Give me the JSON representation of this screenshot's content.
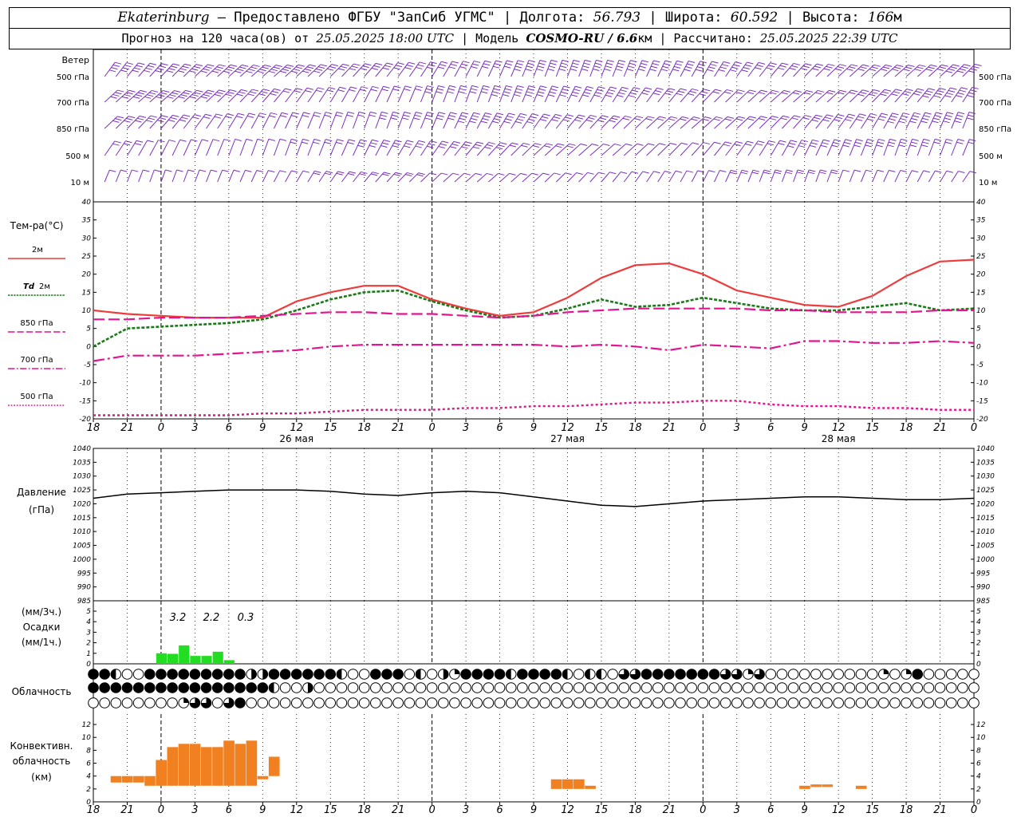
{
  "header": {
    "city": "Ekaterinburg",
    "provider": "– Предоставлено ФГБУ \"ЗапСиб УГМС\"",
    "lon_label": "Долгота:",
    "lon": "56.793",
    "lat_label": "Широта:",
    "lat": "60.592",
    "alt_label": "Высота:",
    "alt": "166",
    "alt_unit": "м",
    "forecast_label": "Прогноз на 120 часа(ов) от",
    "forecast_time": "25.05.2025 18:00 UTC",
    "model_label": "Модель",
    "model": "COSMO-RU / 6.6",
    "model_unit": "км",
    "calc_label": "Рассчитано:",
    "calc_time": "25.05.2025 22:39 UTC"
  },
  "labels": {
    "wind": "Ветер",
    "wind_levels": [
      "500 гПа",
      "700 гПа",
      "850 гПа",
      "500 м",
      "10 м"
    ],
    "temp": "Тем-ра(°С)",
    "t2m": "2м",
    "td": "Td",
    "td2": "2м",
    "t850": "850 гПа",
    "t700": "700 гПа",
    "t500": "500 гПа",
    "pressure": "Давление",
    "pressure_unit": "(гПа)",
    "precip_unit3": "(мм/3ч.)",
    "precip": "Осадки",
    "precip_unit1": "(мм/1ч.)",
    "cloud": "Облачность",
    "conv1": "Конвективн.",
    "conv2": "облачность",
    "conv3": "(км)"
  },
  "colors": {
    "t2m": "#ee3b3b",
    "td": "#1a7a1a",
    "upper": "#e0158f",
    "wind": "#7a2fc0",
    "precip": "#22dd22",
    "conv": "#f08020",
    "pressure": "#000000"
  },
  "chart_data": [
    {
      "type": "line",
      "title": "Тем-ра(°С)",
      "x_ticks": [
        "18",
        "21",
        "0",
        "3",
        "6",
        "9",
        "12",
        "15",
        "18",
        "21",
        "0",
        "3",
        "6",
        "9",
        "12",
        "15",
        "18",
        "21",
        "0",
        "3",
        "6",
        "9",
        "12",
        "15",
        "18",
        "21",
        "0"
      ],
      "dates": [
        "26 мая",
        "27 мая",
        "28 мая"
      ],
      "ylim": [
        -20,
        40
      ],
      "y_ticks": [
        -20,
        -15,
        -10,
        -5,
        0,
        5,
        10,
        15,
        20,
        25,
        30,
        35,
        40
      ],
      "x_hours": [
        0,
        3,
        6,
        9,
        12,
        15,
        18,
        21,
        24,
        27,
        30,
        33,
        36,
        39,
        42,
        45,
        48,
        51,
        54,
        57,
        60,
        63,
        66,
        69,
        72,
        75,
        78
      ],
      "series": [
        {
          "name": "2м",
          "values": [
            10,
            9,
            8.5,
            8,
            8,
            8,
            12.5,
            15,
            16.8,
            16.8,
            13,
            10.5,
            8.5,
            9.5,
            13.5,
            19,
            22.5,
            23,
            20,
            15.5,
            13.5,
            11.5,
            11,
            14,
            19.5,
            23.5,
            24
          ]
        },
        {
          "name": "Td 2м",
          "values": [
            0,
            5,
            5.5,
            6,
            6.5,
            7.5,
            10,
            13,
            15,
            15.5,
            12.5,
            10,
            8,
            8.5,
            10.5,
            13,
            11,
            11.5,
            13.5,
            12,
            10.5,
            10,
            10,
            11,
            12,
            10,
            10.5
          ]
        },
        {
          "name": "850 гПа",
          "values": [
            7.5,
            7.5,
            8,
            8,
            8,
            8.5,
            9,
            9.5,
            9.5,
            9,
            9,
            8.5,
            8,
            8.5,
            9.5,
            10,
            10.5,
            10.5,
            10.5,
            10.5,
            10,
            10,
            9.5,
            9.5,
            9.5,
            10,
            10
          ]
        },
        {
          "name": "700 гПа",
          "values": [
            -4,
            -2.5,
            -2.5,
            -2.5,
            -2,
            -1.5,
            -1,
            0,
            0.5,
            0.5,
            0.5,
            0.5,
            0.5,
            0.5,
            0,
            0.5,
            0,
            -1,
            0.5,
            0,
            -0.5,
            1.5,
            1.5,
            1,
            1,
            1.5,
            1
          ]
        },
        {
          "name": "500 гПа",
          "values": [
            -19,
            -19,
            -19,
            -19,
            -19,
            -18.5,
            -18.5,
            -18,
            -17.5,
            -17.5,
            -17.5,
            -17,
            -17,
            -16.5,
            -16.5,
            -16,
            -15.5,
            -15.5,
            -15,
            -15,
            -16,
            -16.5,
            -16.5,
            -17,
            -17,
            -17.5,
            -17.5
          ]
        }
      ]
    },
    {
      "type": "line",
      "title": "Давление",
      "ylabel": "(гПа)",
      "ylim": [
        985,
        1040
      ],
      "y_ticks": [
        985,
        990,
        995,
        1000,
        1005,
        1010,
        1015,
        1020,
        1025,
        1030,
        1035,
        1040
      ],
      "series": [
        {
          "name": "Давление",
          "values": [
            1022,
            1023.5,
            1024,
            1024.5,
            1025,
            1025,
            1025,
            1024.5,
            1023.5,
            1023,
            1024,
            1024.5,
            1024,
            1022.5,
            1021,
            1019.5,
            1019,
            1020,
            1021,
            1021.5,
            1022,
            1022.5,
            1022.5,
            1022,
            1021.5,
            1021.5,
            1022
          ]
        }
      ]
    },
    {
      "type": "bar",
      "title": "Осадки",
      "ylabel": "(мм/1ч.)",
      "ylim": [
        0,
        5
      ],
      "y_ticks": [
        0,
        1,
        2,
        3,
        4,
        5
      ],
      "bars": [
        {
          "h": 6,
          "v": 1.0
        },
        {
          "h": 7,
          "v": 0.95
        },
        {
          "h": 8,
          "v": 1.75
        },
        {
          "h": 9,
          "v": 0.75
        },
        {
          "h": 10,
          "v": 0.75
        },
        {
          "h": 11,
          "v": 1.15
        },
        {
          "h": 12,
          "v": 0.35
        }
      ],
      "annotations": [
        "3.2",
        "2.2",
        "0.3"
      ]
    },
    {
      "type": "bar",
      "title": "Конвективн. облачность",
      "ylabel": "(км)",
      "ylim": [
        0,
        13
      ],
      "y_ticks": [
        0,
        2,
        4,
        6,
        8,
        10,
        12
      ],
      "bars": [
        {
          "h": 2,
          "b": 3,
          "t": 4
        },
        {
          "h": 3,
          "b": 3,
          "t": 4
        },
        {
          "h": 4,
          "b": 3,
          "t": 4
        },
        {
          "h": 5,
          "b": 2.5,
          "t": 4
        },
        {
          "h": 6,
          "b": 2.5,
          "t": 6.5
        },
        {
          "h": 7,
          "b": 2.5,
          "t": 8.5
        },
        {
          "h": 8,
          "b": 2.5,
          "t": 9
        },
        {
          "h": 9,
          "b": 2.5,
          "t": 9
        },
        {
          "h": 10,
          "b": 2.5,
          "t": 8.5
        },
        {
          "h": 11,
          "b": 2.5,
          "t": 8.5
        },
        {
          "h": 12,
          "b": 2.5,
          "t": 9.5
        },
        {
          "h": 13,
          "b": 2.5,
          "t": 9
        },
        {
          "h": 14,
          "b": 2.5,
          "t": 9.5
        },
        {
          "h": 15,
          "b": 3.5,
          "t": 4
        },
        {
          "h": 16,
          "b": 4,
          "t": 7
        },
        {
          "h": 41,
          "b": 2,
          "t": 3.5
        },
        {
          "h": 42,
          "b": 2,
          "t": 3.5
        },
        {
          "h": 43,
          "b": 2,
          "t": 3.5
        },
        {
          "h": 44,
          "b": 2,
          "t": 2.5
        },
        {
          "h": 63,
          "b": 2,
          "t": 2.5
        },
        {
          "h": 64,
          "b": 2.3,
          "t": 2.7
        },
        {
          "h": 65,
          "b": 2.3,
          "t": 2.7
        },
        {
          "h": 68,
          "b": 2,
          "t": 2.5
        }
      ]
    }
  ]
}
